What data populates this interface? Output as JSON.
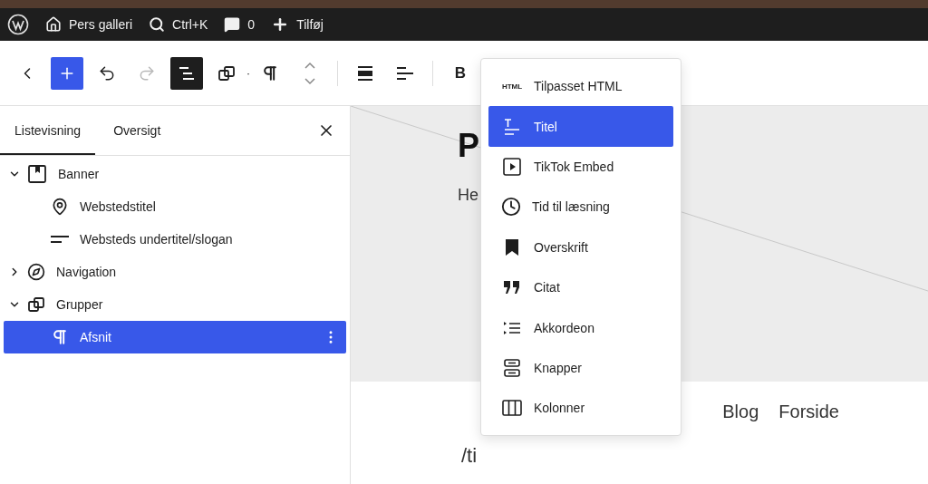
{
  "admin_bar": [
    {
      "kind": "wordpress"
    },
    {
      "kind": "home",
      "label": "Pers galleri"
    },
    {
      "kind": "search",
      "label": "Ctrl+K"
    },
    {
      "kind": "comments",
      "label": "0"
    },
    {
      "kind": "add",
      "label": "Tilføj"
    }
  ],
  "toolbar": [
    {
      "kind": "back"
    },
    {
      "kind": "inserter",
      "selected": true
    },
    {
      "kind": "undo",
      "disabled": false
    },
    {
      "kind": "redo",
      "disabled": true
    },
    {
      "kind": "list-view",
      "selected": true
    },
    {
      "kind": "group"
    },
    {
      "kind": "paragraph",
      "dot": "·"
    },
    {
      "kind": "move"
    },
    {
      "kind": "align"
    },
    {
      "kind": "justify"
    },
    {
      "kind": "bold",
      "label": "B"
    }
  ],
  "sidebar": {
    "tabs": [
      {
        "label": "Listevisning",
        "selected": true
      },
      {
        "label": "Oversigt",
        "selected": false
      }
    ],
    "tree": [
      {
        "label": "Banner",
        "kind": "banner",
        "expanded": true,
        "selected": false,
        "children": [
          {
            "label": "Webstedstitel",
            "kind": "pin",
            "selected": false
          },
          {
            "label": "Websteds undertitel/slogan",
            "kind": "lines",
            "selected": false
          }
        ]
      },
      {
        "label": "Navigation",
        "kind": "compass",
        "expanded": false,
        "selected": false
      },
      {
        "label": "Grupper",
        "kind": "group",
        "expanded": true,
        "selected": false,
        "children": [
          {
            "label": "Afsnit",
            "kind": "paragraph",
            "selected": true
          }
        ]
      }
    ]
  },
  "canvas": {
    "site_title": "P",
    "tagline": "He",
    "nav": [
      "Blog",
      "Forside"
    ],
    "typed_text": "/ti"
  },
  "inserter_menu": [
    {
      "kind": "html",
      "icon_text": "HTML",
      "label": "Tilpasset HTML",
      "selected": false
    },
    {
      "kind": "title",
      "label": "Titel",
      "selected": true
    },
    {
      "kind": "embed",
      "label": "TikTok Embed",
      "selected": false
    },
    {
      "kind": "clock",
      "label": "Tid til læsning",
      "selected": false
    },
    {
      "kind": "bookmark",
      "label": "Overskrift",
      "selected": false
    },
    {
      "kind": "quote",
      "label": "Citat",
      "selected": false
    },
    {
      "kind": "accordion",
      "label": "Akkordeon",
      "selected": false
    },
    {
      "kind": "buttons",
      "label": "Knapper",
      "selected": false
    },
    {
      "kind": "columns",
      "label": "Kolonner",
      "selected": false
    }
  ]
}
